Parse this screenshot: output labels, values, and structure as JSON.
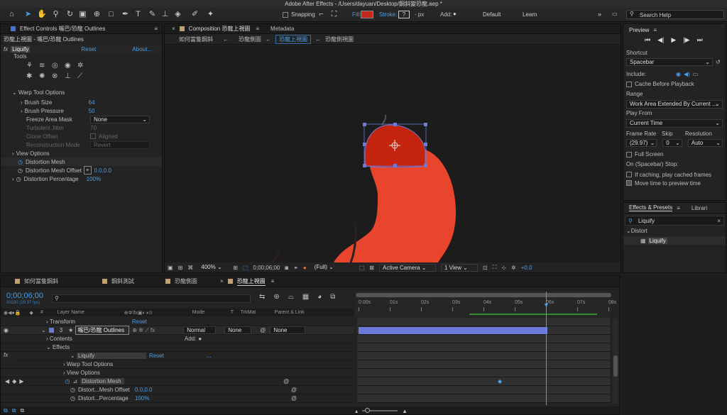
{
  "title": "Adobe After Effects - /Users/dayuan/Desktop/鋼斜變恐龍.aep *",
  "toolbar": {
    "snapping": "Snapping",
    "fill": "Fill:",
    "stroke": "Stroke:",
    "stroke_val": "?",
    "px": "- px",
    "add": "Add:",
    "workspaces": [
      "Default",
      "Learn"
    ],
    "search": "Search Help"
  },
  "effect_controls": {
    "tab": "Effect Controls 嘴巴/恐龍 Outlines",
    "subtitle": "恐龍上視圖 - 嘴巴/恐龍 Outlines",
    "effect": "Liquify",
    "reset": "Reset",
    "about": "About...",
    "tools": "Tools",
    "warp": "Warp Tool Options",
    "brush_size": "Brush Size",
    "brush_size_v": "64",
    "brush_pressure": "Brush Pressure",
    "brush_pressure_v": "50",
    "freeze": "Freeze Area Mask",
    "freeze_v": "None",
    "turbulent": "Turbulent Jitter",
    "turbulent_v": "70",
    "clone": "Clone Offset",
    "aligned": "Aligned",
    "recon": "Reconstruction Mode",
    "recon_v": "Revert",
    "view": "View Options",
    "mesh": "Distortion Mesh",
    "mesh_off": "Distortion Mesh Offset",
    "mesh_off_v": "0.0,0.0",
    "pct": "Distortion Percentage",
    "pct_v": "100%"
  },
  "comp": {
    "tab": "Composition 恐龍上視圖",
    "meta": "Metadata",
    "crumbs": [
      "如何當隻鋼斜",
      "恐龍側面",
      "恐龍上視圖",
      "恐龍側視圖"
    ],
    "zoom": "400%",
    "time": "0;00;06;00",
    "quality": "(Full)",
    "camera": "Active Camera",
    "views": "1 View",
    "exposure": "+0.0"
  },
  "preview": {
    "title": "Preview",
    "shortcut": "Shortcut",
    "shortcut_v": "Spacebar",
    "include": "Include:",
    "cache": "Cache Before Playback",
    "range": "Range",
    "range_v": "Work Area Extended By Current ...",
    "playfrom": "Play From",
    "playfrom_v": "Current Time",
    "framerate": "Frame Rate",
    "skip": "Skip",
    "resolution": "Resolution",
    "fr_v": "(29.97)",
    "skip_v": "0",
    "res_v": "Auto",
    "fullscreen": "Full Screen",
    "onstop": "On (Spacebar) Stop:",
    "ifcache": "If caching, play cached frames",
    "movetime": "Move time to preview time"
  },
  "effects_presets": {
    "tab": "Effects & Presets",
    "libs": "Librari",
    "search": "Liquify",
    "category": "Distort",
    "item": "Liquify"
  },
  "timeline": {
    "tabs": [
      "如何當隻鋼斜",
      "鋼斜測試",
      "恐龍側面",
      "恐龍上視圖"
    ],
    "time": "0;00;06;00",
    "fps": "00180 (29.97 fps)",
    "search_ph": "",
    "cols": {
      "layer": "Layer Name",
      "mode": "Mode",
      "t": "T",
      "trkmat": "TrkMat",
      "parent": "Parent & Link"
    },
    "rows": [
      {
        "name": "Transform",
        "val": "Reset"
      },
      {
        "num": "3",
        "name": "嘴巴/恐龍 Outlines",
        "mode": "Normal",
        "trk": "None",
        "parent": "None"
      },
      {
        "name": "Contents",
        "val": "Add:"
      },
      {
        "name": "Effects"
      },
      {
        "name": "Liquify",
        "val": "Reset",
        "extra": "..."
      },
      {
        "name": "Warp Tool Options"
      },
      {
        "name": "View Options"
      },
      {
        "name": "Distortion Mesh"
      },
      {
        "name": "Distort...Mesh Offset",
        "val": "0.0,0.0"
      },
      {
        "name": "Distort...Percentage",
        "val": "100%"
      }
    ],
    "ruler": [
      "0:00s",
      "01s",
      "02s",
      "03s",
      "04s",
      "05s",
      "06s",
      "07s",
      "08s"
    ],
    "playhead_fraction": 0.75
  }
}
